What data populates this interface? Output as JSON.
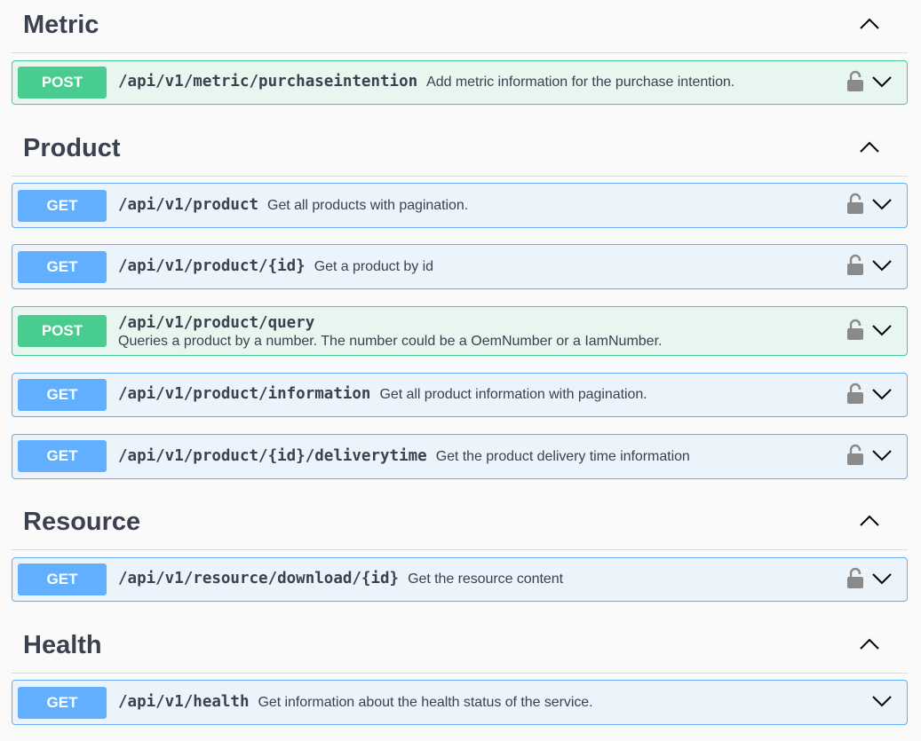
{
  "colors": {
    "get": "#61affe",
    "post": "#49cc90",
    "get_bg": "#ebf3fb",
    "post_bg": "#e8f6f0"
  },
  "icons": {
    "collapse": "chevron-up-icon",
    "expand": "chevron-down-icon",
    "auth": "lock-icon"
  },
  "sections": [
    {
      "title": "Metric",
      "operations": [
        {
          "method": "POST",
          "path": "/api/v1/metric/purchaseintention",
          "summary": "Add metric information for the purchase intention."
        }
      ]
    },
    {
      "title": "Product",
      "operations": [
        {
          "method": "GET",
          "path": "/api/v1/product",
          "summary": "Get all products with pagination."
        },
        {
          "method": "GET",
          "path": "/api/v1/product/{id}",
          "summary": "Get a product by id"
        },
        {
          "method": "POST",
          "path": "/api/v1/product/query",
          "summary": "Queries a product by a number. The number could be a OemNumber or a IamNumber."
        },
        {
          "method": "GET",
          "path": "/api/v1/product/information",
          "summary": "Get all product information with pagination."
        },
        {
          "method": "GET",
          "path": "/api/v1/product/{id}/deliverytime",
          "summary": "Get the product delivery time information"
        }
      ]
    },
    {
      "title": "Resource",
      "operations": [
        {
          "method": "GET",
          "path": "/api/v1/resource/download/{id}",
          "summary": "Get the resource content"
        }
      ]
    },
    {
      "title": "Health",
      "operations": [
        {
          "method": "GET",
          "path": "/api/v1/health",
          "summary": "Get information about the health status of the service."
        }
      ]
    }
  ]
}
